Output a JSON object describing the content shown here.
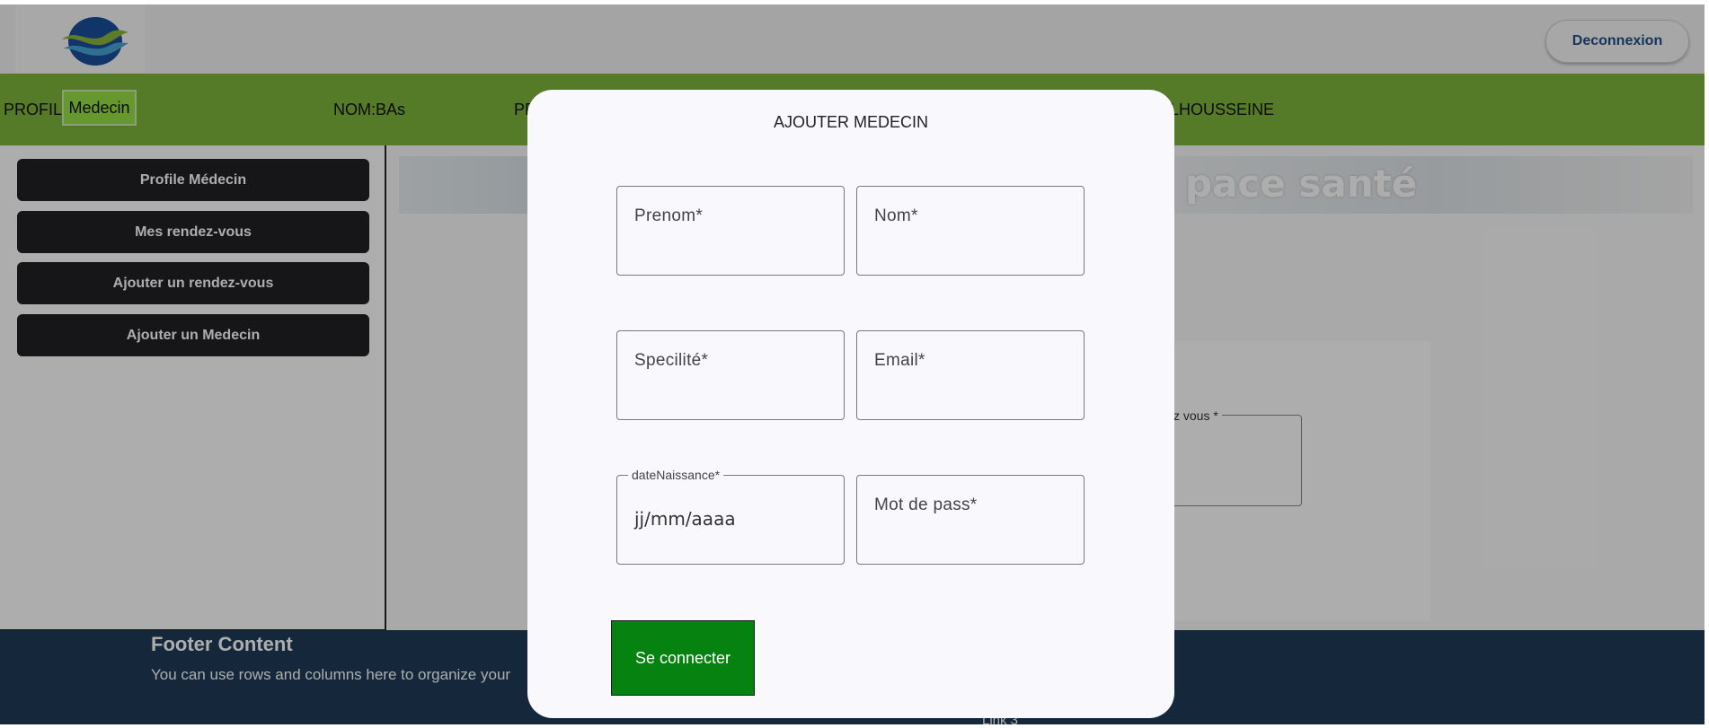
{
  "header": {
    "logout_label": "Deconnexion",
    "logo_icon": "wave-logo-icon"
  },
  "profile_bar": {
    "profile_label": "PROFIL:",
    "profile_value": "Medecin",
    "nom_label": "NOM:BAs",
    "prenom_partial": "PR",
    "lastname_partial": "LHOUSSEINE"
  },
  "sidebar": {
    "items": [
      {
        "label": "Profile Médecin"
      },
      {
        "label": "Mes rendez-vous"
      },
      {
        "label": "Ajouter un rendez-vous"
      },
      {
        "label": "Ajouter un Medecin"
      }
    ]
  },
  "main": {
    "banner_text": "pace santé",
    "rdv_legend": "z vous *"
  },
  "footer": {
    "title": "Footer Content",
    "text": "You can use rows and columns here to organize your",
    "link": "Link 3"
  },
  "modal": {
    "title": "AJOUTER MEDECIN",
    "fields": {
      "prenom": "Prenom*",
      "nom": "Nom*",
      "specialite": "Specilité*",
      "email": "Email*",
      "date_legend": "dateNaissance*",
      "date_value": "jj/mm/aaaa",
      "password": "Mot de pass*"
    },
    "submit_label": "Se connecter"
  },
  "colors": {
    "green_bar": "#7fb53c",
    "badge": "#97e046",
    "sidebar_button": "#212125",
    "submit": "#05820f",
    "footer": "#1f3c57"
  }
}
